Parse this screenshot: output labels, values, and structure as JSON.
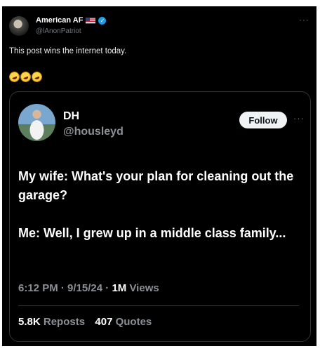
{
  "outer_post": {
    "author_name": "American AF",
    "handle": "@lAnonPatriot",
    "more": "···",
    "text": "This post wins the internet today."
  },
  "icons": {
    "flag": "us-flag-icon",
    "verified": "verified-badge-icon",
    "emoji": "rolling-on-floor-laughing-emoji"
  },
  "quoted_post": {
    "author_name": "DH",
    "handle": "@housleyd",
    "follow_label": "Follow",
    "more": "···",
    "body": [
      "My wife: What's your plan for cleaning out the garage?",
      "Me: Well, I grew up in a middle class family..."
    ],
    "time": "6:12 PM",
    "date": "9/15/24",
    "views_count": "1M",
    "views_label": "Views",
    "reposts_count": "5.8K",
    "reposts_label": "Reposts",
    "quotes_count": "407",
    "quotes_label": "Quotes"
  },
  "colors": {
    "background": "#000000",
    "muted_text": "#71767b",
    "verified_blue": "#1d9bf0",
    "follow_bg": "#eff3f4"
  }
}
